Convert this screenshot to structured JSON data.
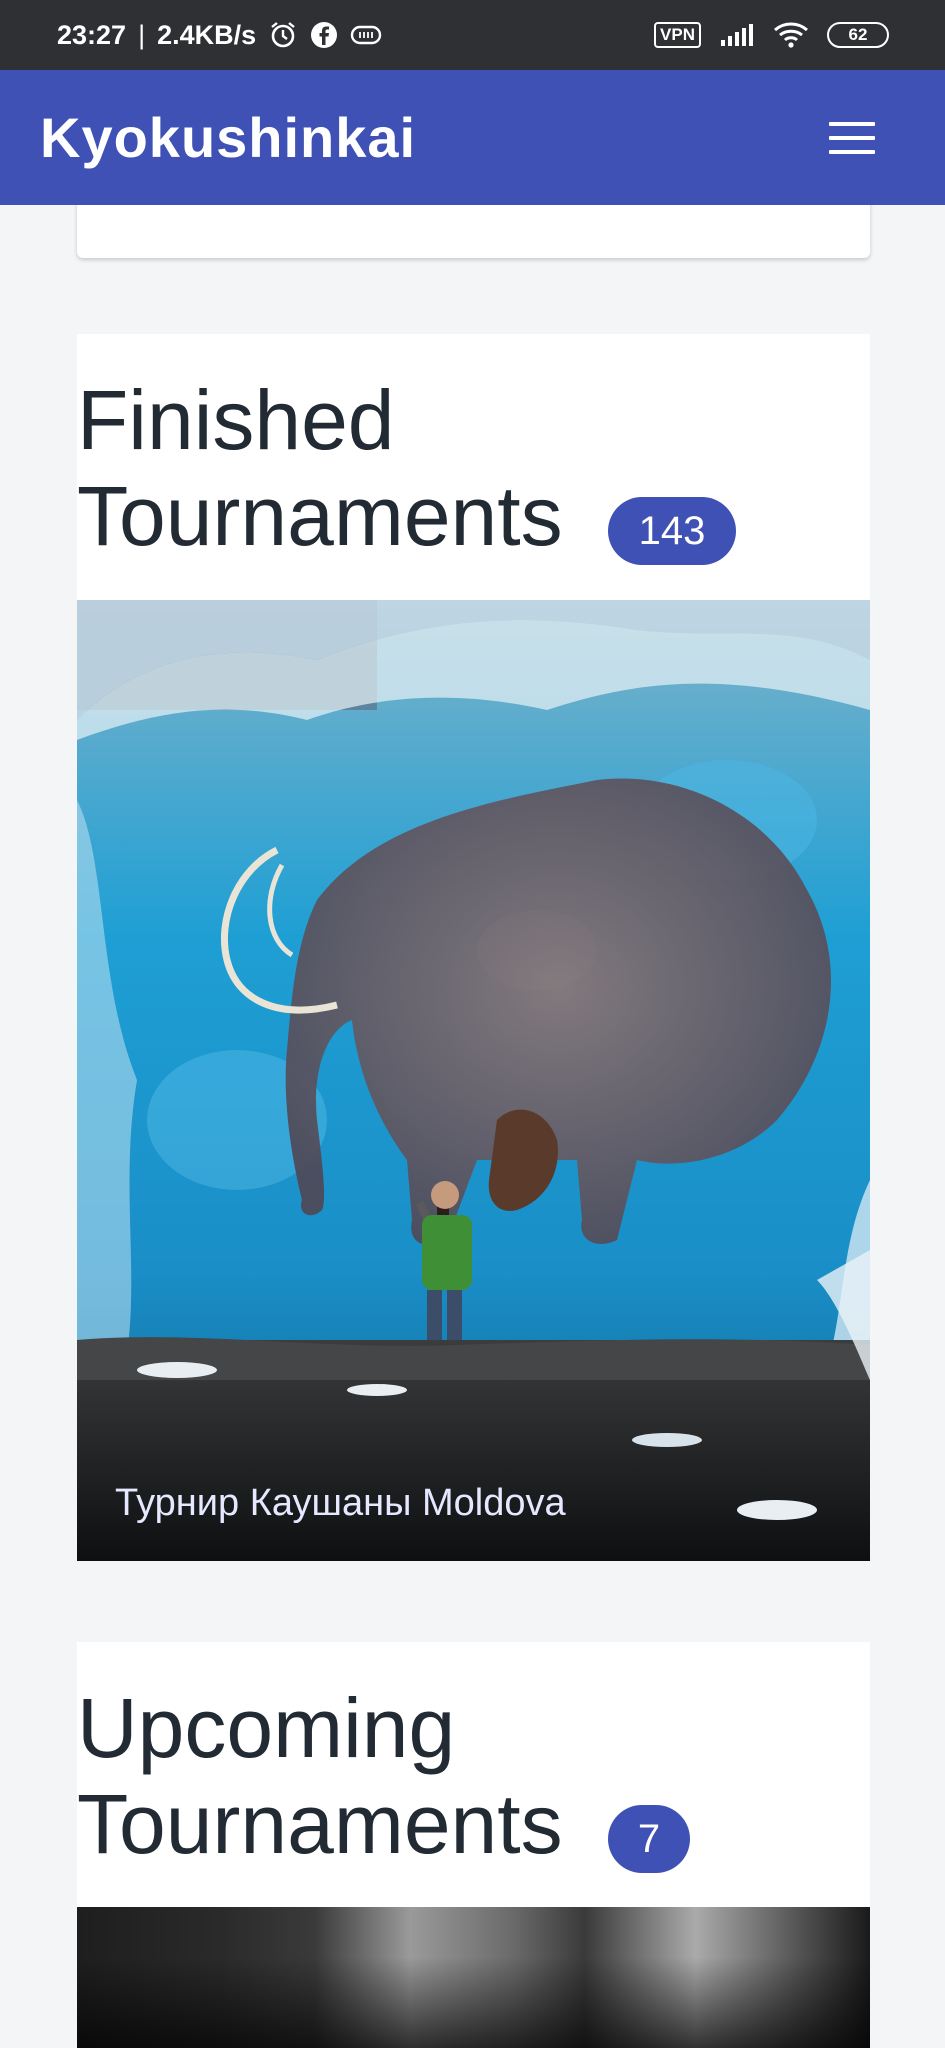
{
  "status_bar": {
    "time": "23:27",
    "speed": "2.4KB/s",
    "icons": [
      "alarm-icon",
      "facebook-icon",
      "cast-icon",
      "vpn-icon",
      "signal-icon",
      "wifi-icon"
    ],
    "vpn_label": "VPN",
    "battery": "62"
  },
  "app_bar": {
    "title": "Kyokushinkai",
    "menu_icon": "hamburger-menu-icon",
    "color": "#3f51b5"
  },
  "finished": {
    "title_line1": "Finished",
    "title_line2": "Tournaments",
    "count": "143",
    "cards": [
      {
        "caption": "Турнир Каушаны Moldova"
      }
    ]
  },
  "upcoming": {
    "title_line1": "Upcoming",
    "title_line2": "Tournaments",
    "count": "7"
  }
}
